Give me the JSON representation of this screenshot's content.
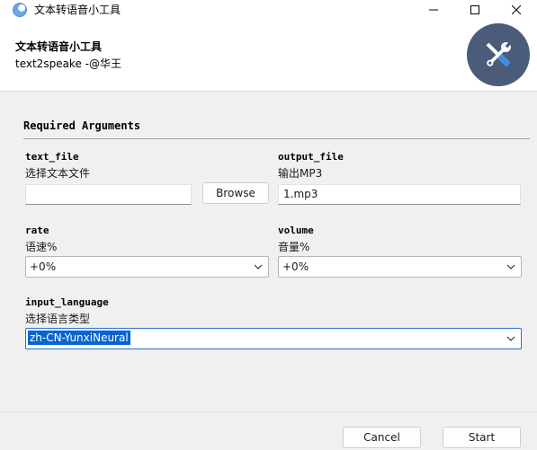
{
  "window": {
    "title": "文本转语音小工具",
    "controls": [
      "minimize-icon",
      "maximize-icon",
      "close-icon"
    ]
  },
  "header": {
    "title": "文本转语音小工具",
    "subtitle": "text2speake -@华王",
    "logo_icon": "tools-icon",
    "logo_color": "#4a5c7a"
  },
  "section": {
    "title": "Required Arguments"
  },
  "fields": {
    "text_file": {
      "label": "text_file",
      "help": "选择文本文件",
      "value": "",
      "browse_label": "Browse"
    },
    "output_file": {
      "label": "output_file",
      "help": "输出MP3",
      "value": "1.mp3"
    },
    "rate": {
      "label": "rate",
      "help": "语速%",
      "value": "+0%"
    },
    "volume": {
      "label": "volume",
      "help": "音量%",
      "value": "+0%"
    },
    "input_language": {
      "label": "input_language",
      "help": "选择语言类型",
      "value": "zh-CN-YunxiNeural"
    }
  },
  "footer": {
    "cancel_label": "Cancel",
    "start_label": "Start"
  },
  "colors": {
    "focus_highlight": "#0a64d0",
    "header_bg": "#ffffff",
    "body_bg": "#f0f0f0"
  }
}
